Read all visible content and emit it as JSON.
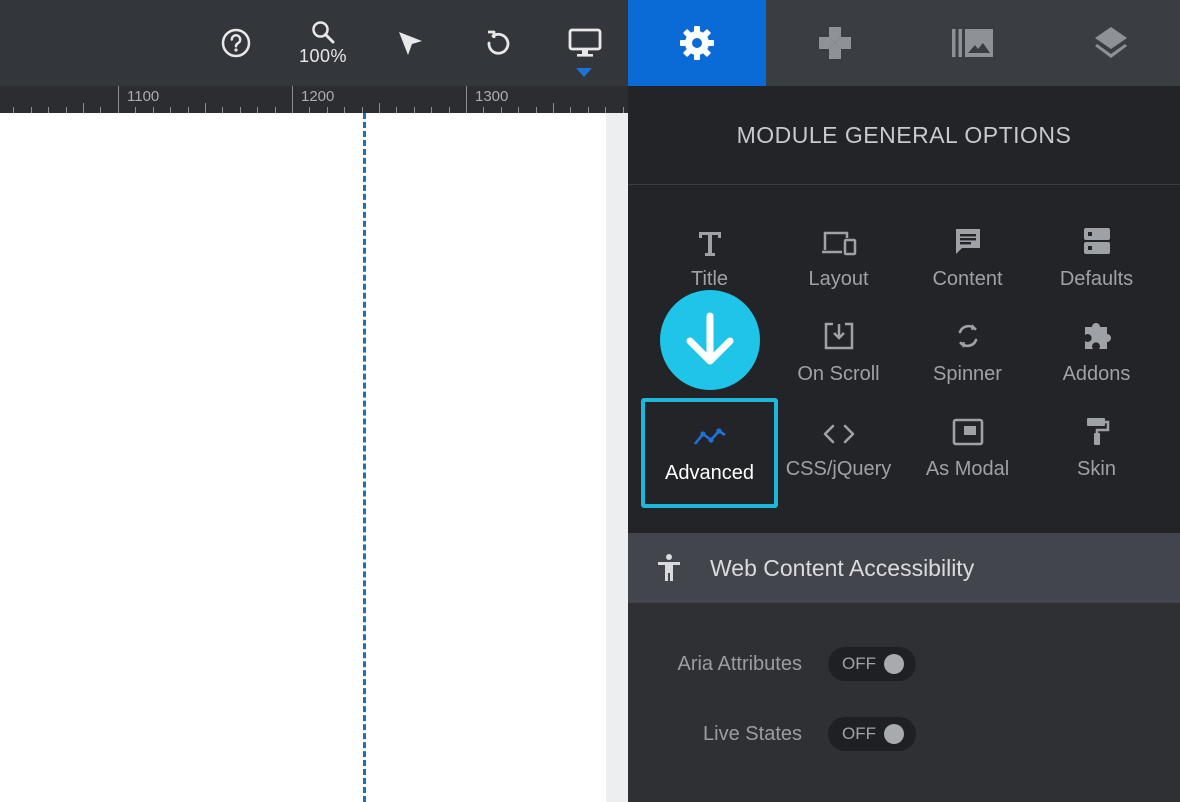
{
  "toolbar": {
    "zoom": "100%",
    "icons": [
      "help-icon",
      "zoom-icon",
      "pointer-icon",
      "undo-icon",
      "desktop-icon"
    ]
  },
  "tabs": [
    {
      "icon": "gear-icon",
      "active": true
    },
    {
      "icon": "gamepad-icon",
      "active": false
    },
    {
      "icon": "media-library-icon",
      "active": false
    },
    {
      "icon": "layers-icon",
      "active": false
    }
  ],
  "ruler": {
    "labels": [
      "1100",
      "1200",
      "1300"
    ]
  },
  "panel": {
    "title": "MODULE GENERAL OPTIONS",
    "items": [
      {
        "label": "Title",
        "icon": "title-icon"
      },
      {
        "label": "Layout",
        "icon": "devices-icon"
      },
      {
        "label": "Content",
        "icon": "message-icon"
      },
      {
        "label": "Defaults",
        "icon": "defaults-icon"
      },
      {
        "label": "",
        "icon": "download-badge-icon"
      },
      {
        "label": "On Scroll",
        "icon": "scroll-download-icon"
      },
      {
        "label": "Spinner",
        "icon": "spinner-icon"
      },
      {
        "label": "Addons",
        "icon": "puzzle-icon"
      },
      {
        "label": "Advanced",
        "icon": "trend-icon"
      },
      {
        "label": "CSS/jQuery",
        "icon": "code-icon"
      },
      {
        "label": "As Modal",
        "icon": "modal-icon"
      },
      {
        "label": "Skin",
        "icon": "paint-roller-icon"
      }
    ]
  },
  "section": {
    "title": "Web Content Accessibility",
    "icon": "accessibility-icon"
  },
  "options": [
    {
      "label": "Aria Attributes",
      "value": "OFF"
    },
    {
      "label": "Live States",
      "value": "OFF"
    }
  ],
  "colors": {
    "accent_blue": "#0b6bd6",
    "highlight_cyan": "#1fb6dc",
    "guide_blue": "#1d6fb6"
  }
}
